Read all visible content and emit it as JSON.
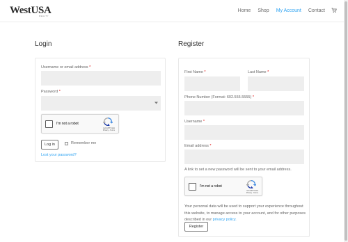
{
  "header": {
    "logo_main": "WestUSA",
    "logo_sub": "REALTY",
    "nav": [
      "Home",
      "Shop",
      "My Account",
      "Contact"
    ]
  },
  "login": {
    "title": "Login",
    "username_label": "Username or email address",
    "password_label": "Password",
    "required_mark": "*",
    "captcha_label": "I'm not a robot",
    "captcha_brand": "reCAPTCHA",
    "captcha_links": "Privacy - Terms",
    "login_button": "Log in",
    "remember_label": "Remember me",
    "lost_password": "Lost your password?"
  },
  "register": {
    "title": "Register",
    "first_name_label": "First Name",
    "last_name_label": "Last Name",
    "phone_label": "Phone Number (Format: 602.555.5555)",
    "username_label": "Username",
    "email_label": "Email address",
    "required_mark": "*",
    "password_note": "A link to set a new password will be sent to your email address.",
    "captcha_label": "I'm not a robot",
    "captcha_brand": "reCAPTCHA",
    "captcha_links": "Privacy - Terms",
    "privacy_text": "Your personal data will be used to support your experience throughout this website, to manage access to your account, and for other purposes described in our",
    "privacy_link": "privacy policy.",
    "register_button": "Register"
  },
  "colors": {
    "accent": "#2ea3f2",
    "required": "#dd0000",
    "field_bg": "#eeeeee"
  }
}
